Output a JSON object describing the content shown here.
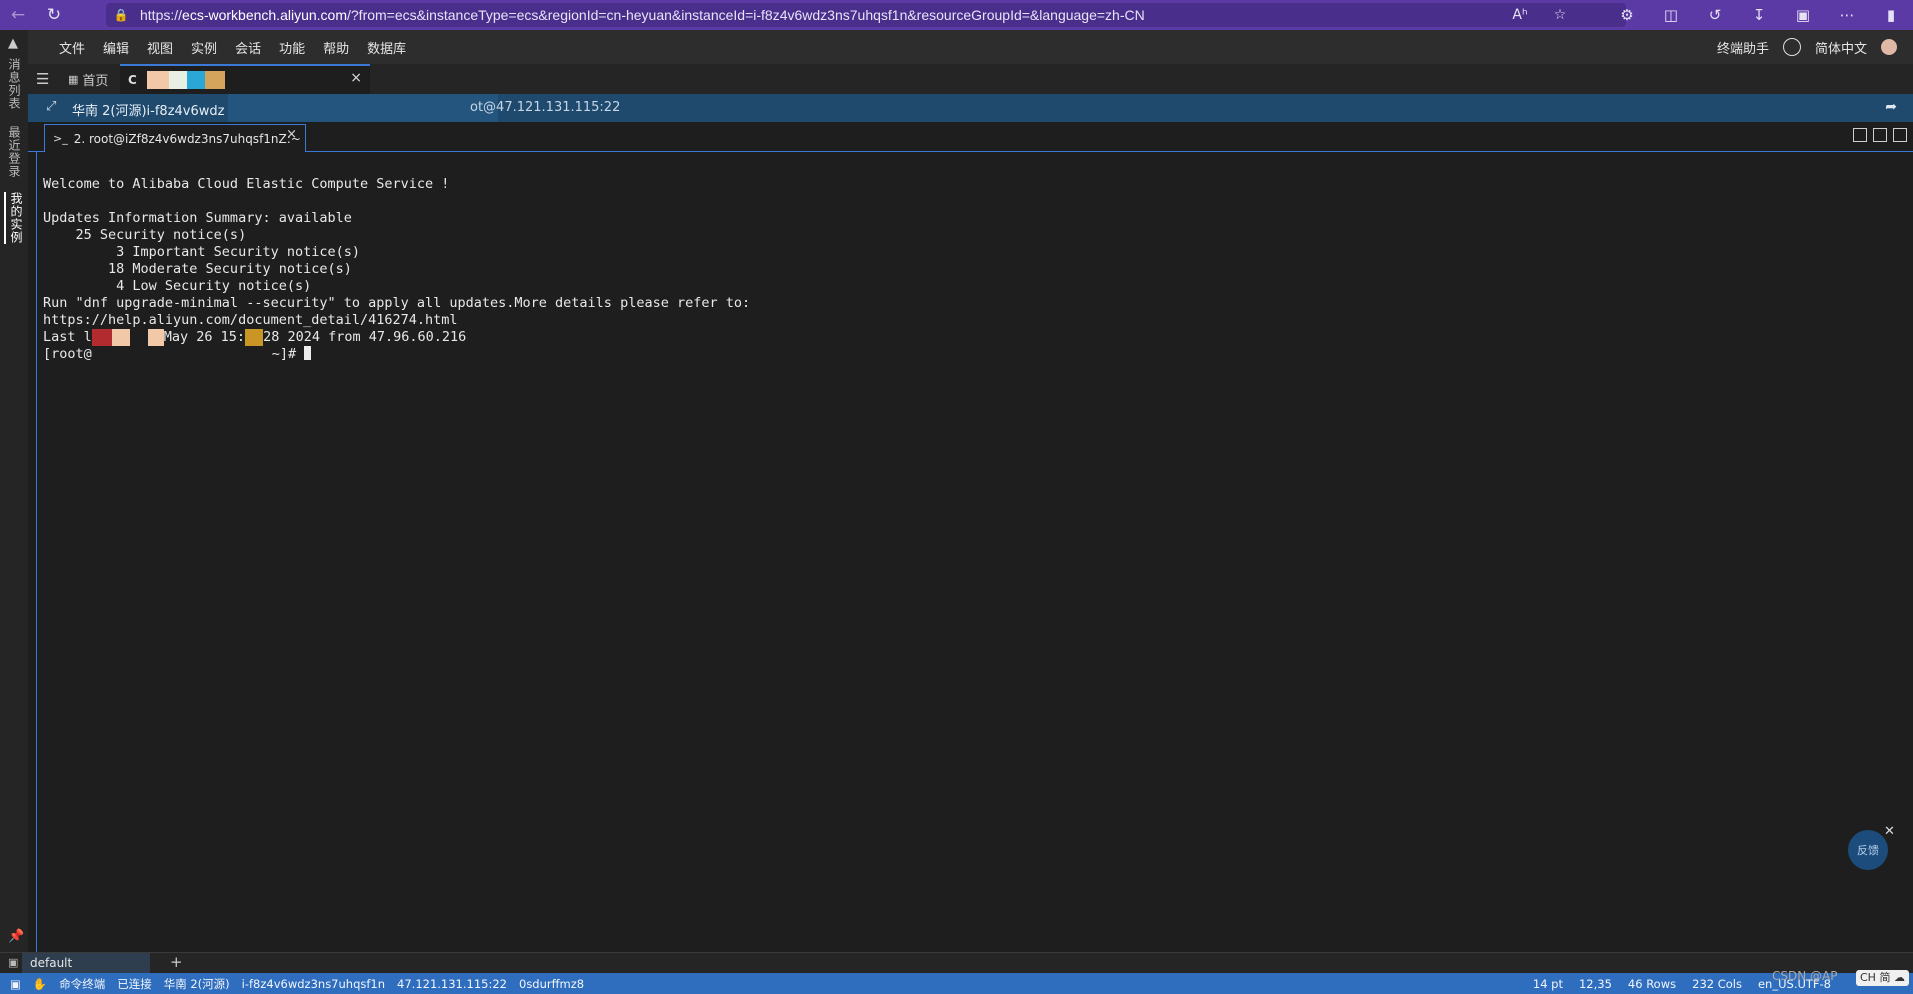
{
  "browser": {
    "url_prefix": "https://",
    "url_domain": "ecs-workbench.aliyun.com",
    "url_rest": "/?from=ecs&instanceType=ecs&regionId=cn-heyuan&instanceId=i-f8z4v6wdz3ns7uhqsf1n&resourceGroupId=&language=zh-CN",
    "read_aloud_icon": "Aʰ"
  },
  "activity": {
    "tabs": [
      "消息列表",
      "最近登录",
      "我的实例"
    ]
  },
  "menubar": {
    "items": [
      "文件",
      "编辑",
      "视图",
      "实例",
      "会话",
      "功能",
      "帮助",
      "数据库"
    ],
    "assistant": "终端助手",
    "language": "简体中文"
  },
  "tabs": {
    "home": "首页",
    "terminal_prefix": "C",
    "close": "×"
  },
  "infobar": {
    "text": "华南 2(河源)i-f8z4v6wdz",
    "text_right": "ot@47.121.131.115:22"
  },
  "session": {
    "label": "2. root@iZf8z4v6wdz3ns7uhqsf1nZ:~",
    "close": "×"
  },
  "terminal": {
    "lines": [
      "Welcome to Alibaba Cloud Elastic Compute Service !",
      "",
      "Updates Information Summary: available",
      "    25 Security notice(s)",
      "         3 Important Security notice(s)",
      "        18 Moderate Security notice(s)",
      "         4 Low Security notice(s)",
      "Run \"dnf upgrade-minimal --security\" to apply all updates.More details please refer to:",
      "https://help.aliyun.com/document_detail/416274.html"
    ],
    "last_login_a": "Last l",
    "last_login_b": "May 26 15:",
    "last_login_c": "28 2024 from 47.96.60.216",
    "prompt_a": "[root@",
    "prompt_b": "~]#"
  },
  "feedback": {
    "label": "反馈"
  },
  "sessionbar": {
    "default_label": "default"
  },
  "status": {
    "left": [
      "命令终端",
      "已连接",
      "华南 2(河源)",
      "i-f8z4v6wdz3ns7uhqsf1n",
      "47.121.131.115:22",
      "0sdurffmz8"
    ],
    "font_size": "14 pt",
    "cursor": "12,35",
    "rows": "46 Rows",
    "cols": "232 Cols",
    "encoding": "en_US.UTF-8"
  },
  "watermark": "CSDN @AP",
  "ime_label": "CH 简 ☁"
}
